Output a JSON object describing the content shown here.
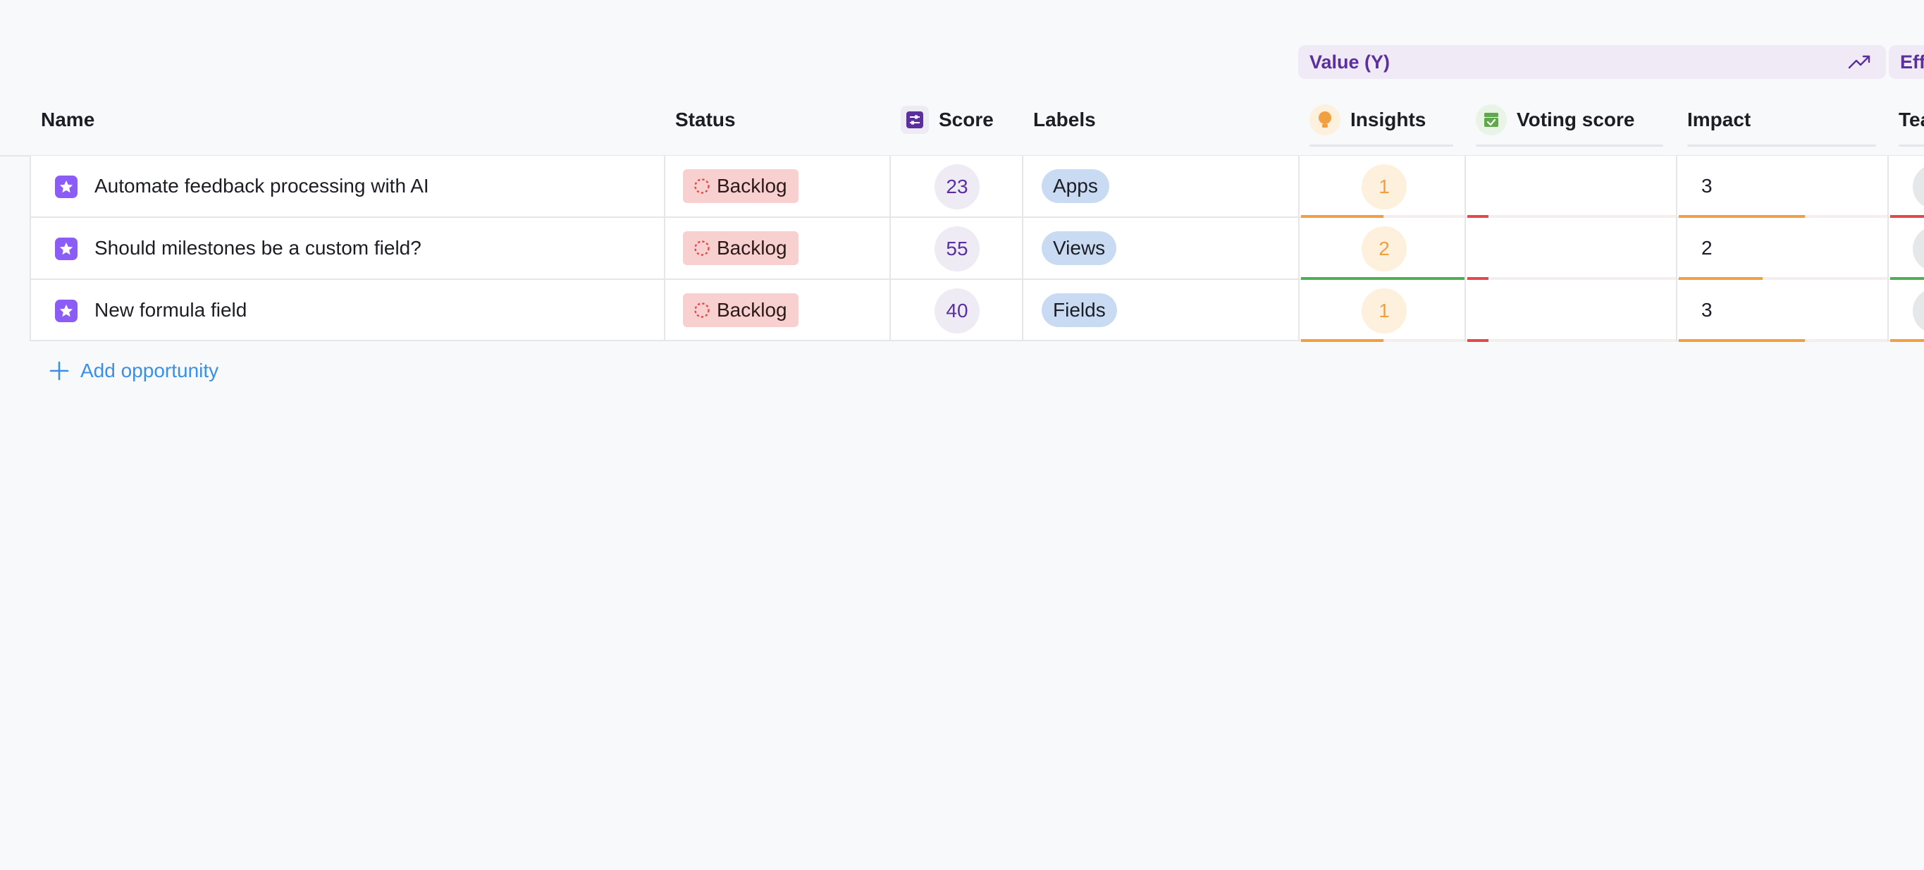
{
  "groups": {
    "value_label": "Value (Y)",
    "effort_label": "Effort (X)"
  },
  "columns": {
    "name": "Name",
    "status": "Status",
    "score": "Score",
    "labels": "Labels",
    "insights": "Insights",
    "voting_score": "Voting score",
    "impact": "Impact",
    "team": "Team"
  },
  "colors": {
    "accent_purple": "#5b2f9e",
    "status_backlog_bg": "#f8d0d0",
    "insight_orange": "#f0a040",
    "bar_green": "#4caf50",
    "bar_red": "#e54848",
    "link_blue": "#3b8fe8"
  },
  "rows": [
    {
      "name": "Automate feedback processing with AI",
      "status": "Backlog",
      "score": "23",
      "label": "Apps",
      "insights": "1",
      "insights_level": 0.5,
      "voting_level": 0.1,
      "impact": "3",
      "impact_level": 0.6
    },
    {
      "name": "Should milestones be a custom field?",
      "status": "Backlog",
      "score": "55",
      "label": "Views",
      "insights": "2",
      "insights_level": 1.0,
      "voting_level": 0.1,
      "impact": "2",
      "impact_level": 0.4
    },
    {
      "name": "New formula field",
      "status": "Backlog",
      "score": "40",
      "label": "Fields",
      "insights": "1",
      "insights_level": 0.5,
      "voting_level": 0.1,
      "impact": "3",
      "impact_level": 0.6
    }
  ],
  "add_row_label": "Add opportunity",
  "icons": {
    "trend": "trending-up-icon",
    "score": "sliders-icon",
    "insights": "lightbulb-icon",
    "voting": "ballot-box-icon",
    "row": "star-icon",
    "status": "dashed-circle-icon",
    "add": "plus-icon"
  }
}
